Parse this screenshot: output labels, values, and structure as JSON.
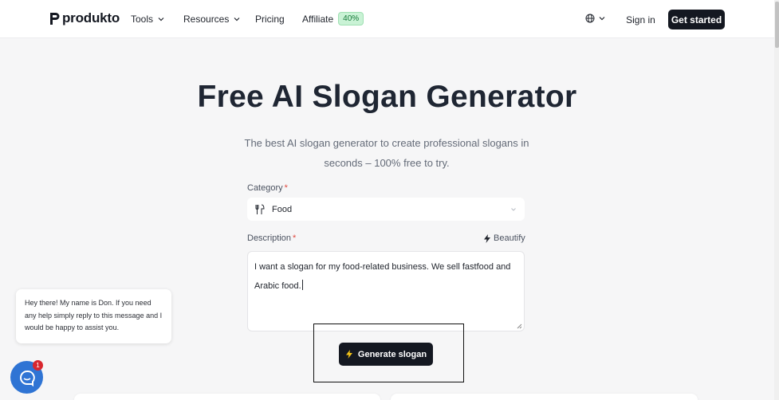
{
  "header": {
    "logo": "produkto",
    "nav": {
      "tools": "Tools",
      "resources": "Resources",
      "pricing": "Pricing",
      "affiliate": "Affiliate",
      "affiliate_badge": "40%"
    },
    "language_icon": "globe-icon",
    "sign_in": "Sign in",
    "get_started": "Get started"
  },
  "hero": {
    "title": "Free AI Slogan Generator",
    "subtitle": "The best AI slogan generator to create professional slogans in seconds – 100% free to try."
  },
  "form": {
    "category_label": "Category",
    "required_mark": "*",
    "category_value": "Food",
    "category_icon": "fork-knife-icon",
    "description_label": "Description",
    "beautify_label": "Beautify",
    "description_value": "I want a slogan for my food-related business. We sell fastfood and Arabic food.",
    "generate_label": "Generate slogan"
  },
  "chat": {
    "message": "Hey there! My name is Don. If you need any help simply reply to this message and I would be happy to assist you.",
    "unread_count": "1"
  },
  "colors": {
    "background": "#f6f6f7",
    "primary_button": "#141821",
    "badge_bg": "#c9f2d5",
    "chat_launcher": "#2f74d4",
    "notification": "#d9272e"
  }
}
